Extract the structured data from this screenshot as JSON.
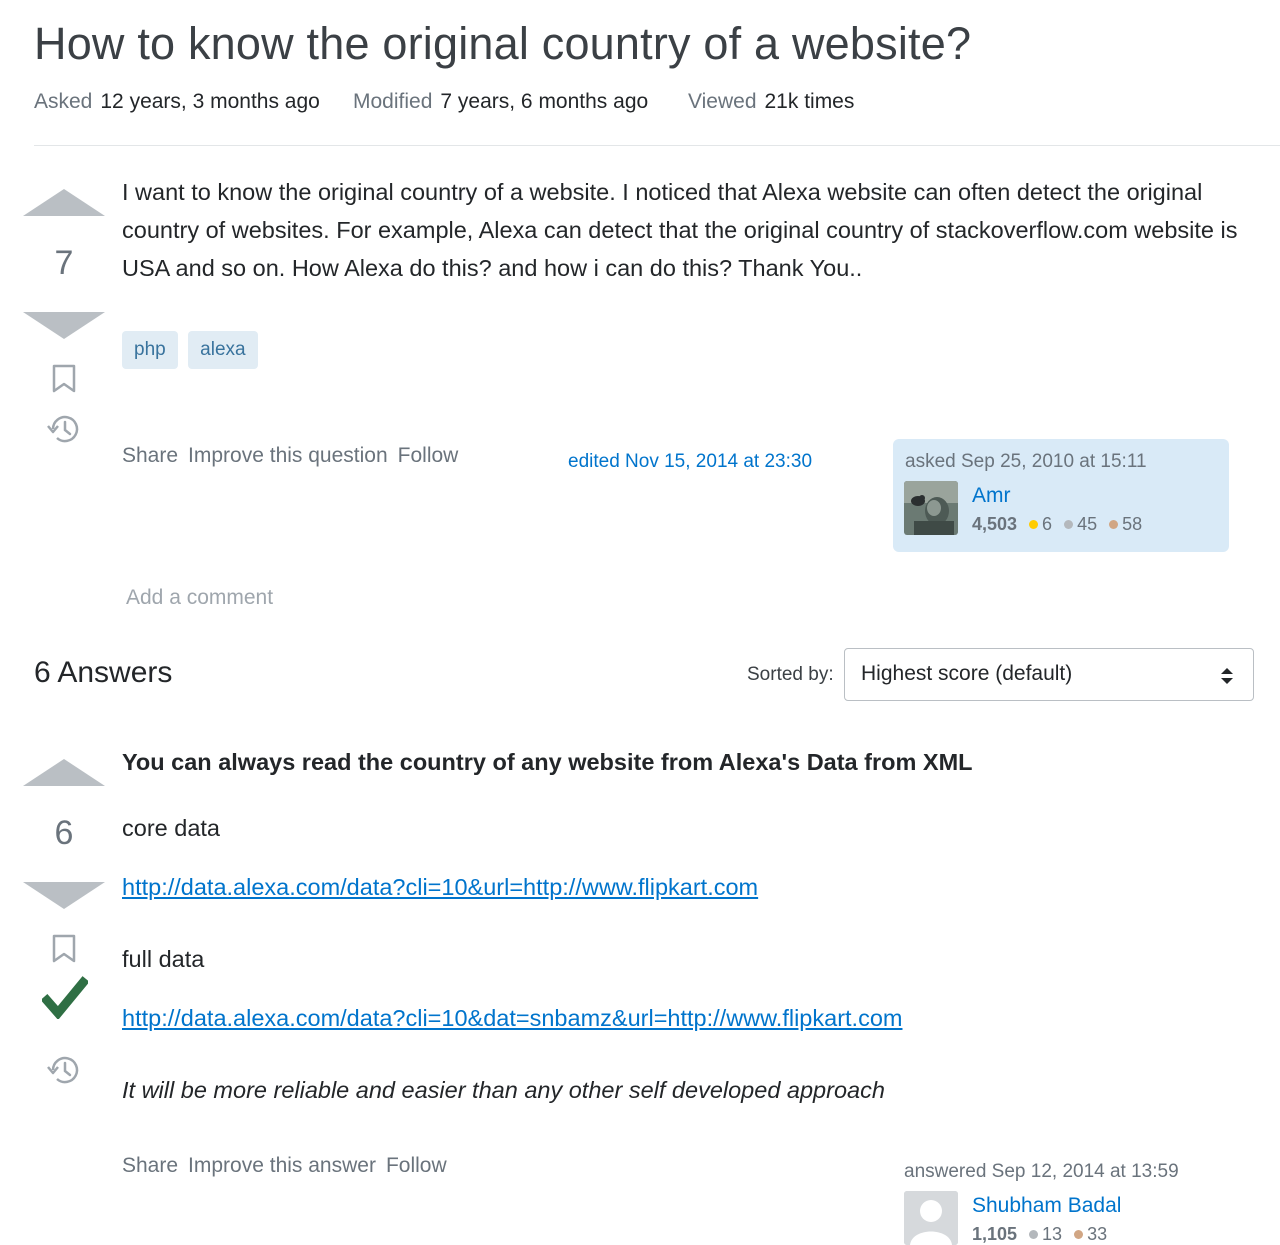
{
  "question": {
    "title": "How to know the original country of a website?",
    "meta": {
      "asked_label": "Asked",
      "asked_value": "12 years, 3 months ago",
      "modified_label": "Modified",
      "modified_value": "7 years, 6 months ago",
      "viewed_label": "Viewed",
      "viewed_value": "21k times"
    },
    "score": "7",
    "body": "I want to know the original country of a website. I noticed that Alexa website can often detect the original country of websites. For example, Alexa can detect that the original country of stackoverflow.com website is USA and so on. How Alexa do this? and how i can do this? Thank You..",
    "tags": [
      "php",
      "alexa"
    ],
    "menu": {
      "share": "Share",
      "improve": "Improve this question",
      "follow": "Follow"
    },
    "edited": "edited Nov 15, 2014 at 23:30",
    "owner": {
      "time": "asked Sep 25, 2010 at 15:11",
      "name": "Amr",
      "reputation": "4,503",
      "gold": "6",
      "silver": "45",
      "bronze": "58"
    },
    "add_comment": "Add a comment"
  },
  "answers_header": {
    "count": "6 Answers",
    "sorted_by_label": "Sorted by:",
    "sort_value": "Highest score (default)"
  },
  "answer": {
    "score": "6",
    "heading": "You can always read the country of any website from Alexa's Data from XML",
    "core_label": "core data",
    "core_link": "http://data.alexa.com/data?cli=10&url=http://www.flipkart.com",
    "full_label": "full data",
    "full_link": "http://data.alexa.com/data?cli=10&dat=snbamz&url=http://www.flipkart.com",
    "note": "It will be more reliable and easier than any other self developed approach",
    "menu": {
      "share": "Share",
      "improve": "Improve this answer",
      "follow": "Follow"
    },
    "owner": {
      "time": "answered Sep 12, 2014 at 13:59",
      "name": "Shubham Badal",
      "reputation": "1,105",
      "silver": "13",
      "bronze": "33"
    }
  },
  "colors": {
    "gold": "#ffcc01",
    "silver": "#b4b8bc",
    "bronze": "#d1a684",
    "accepted": "#2f6f44",
    "link": "#0074cc",
    "tag_bg": "#e1ecf4"
  }
}
